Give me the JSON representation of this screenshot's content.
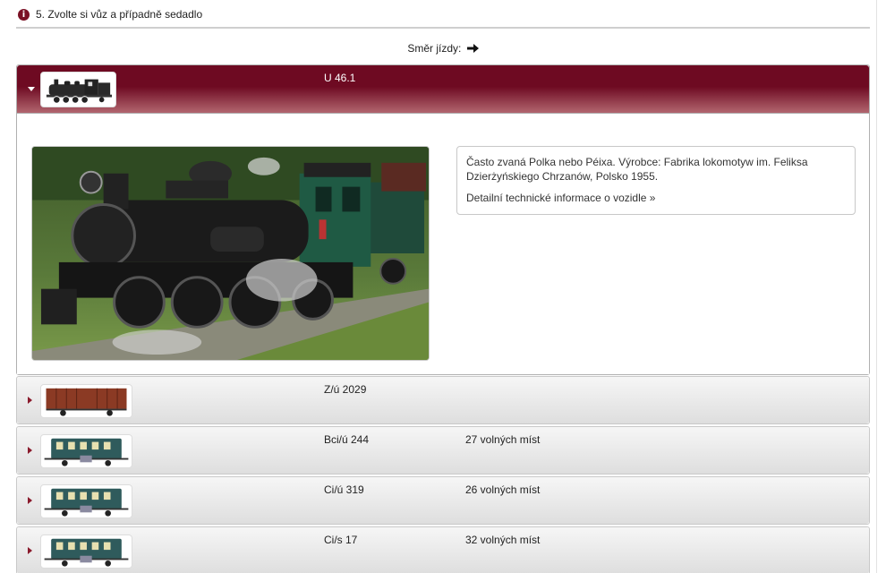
{
  "section": {
    "title": "5. Zvolte si vůz a případně sedadlo",
    "info_icon_glyph": "i"
  },
  "direction": {
    "label": "Směr jízdy:",
    "icon": "arrow-right-icon"
  },
  "cars": [
    {
      "name": "U 46.1",
      "seats": "",
      "expanded": true,
      "thumbnail": "steam-locomotive-icon",
      "description": "Často zvaná Polka nebo Péixa. Výrobce: Fabrika lokomotyw im. Feliksa Dzierżyńskiego Chrzanów, Polsko 1955.",
      "details_link": "Detailní technické informace o vozidle »"
    },
    {
      "name": "Z/ú 2029",
      "seats": "",
      "expanded": false,
      "thumbnail": "freight-wagon-icon"
    },
    {
      "name": "Bci/ú 244",
      "seats": "27 volných míst",
      "expanded": false,
      "thumbnail": "passenger-coach-icon"
    },
    {
      "name": "Ci/ú 319",
      "seats": "26 volných míst",
      "expanded": false,
      "thumbnail": "passenger-coach-icon"
    },
    {
      "name": "Ci/s 17",
      "seats": "32 volných míst",
      "expanded": false,
      "thumbnail": "passenger-coach-icon"
    }
  ],
  "colors": {
    "accent": "#6e0a22",
    "coach_green": "#2f5b5c",
    "wagon_brown": "#8b3a24"
  }
}
